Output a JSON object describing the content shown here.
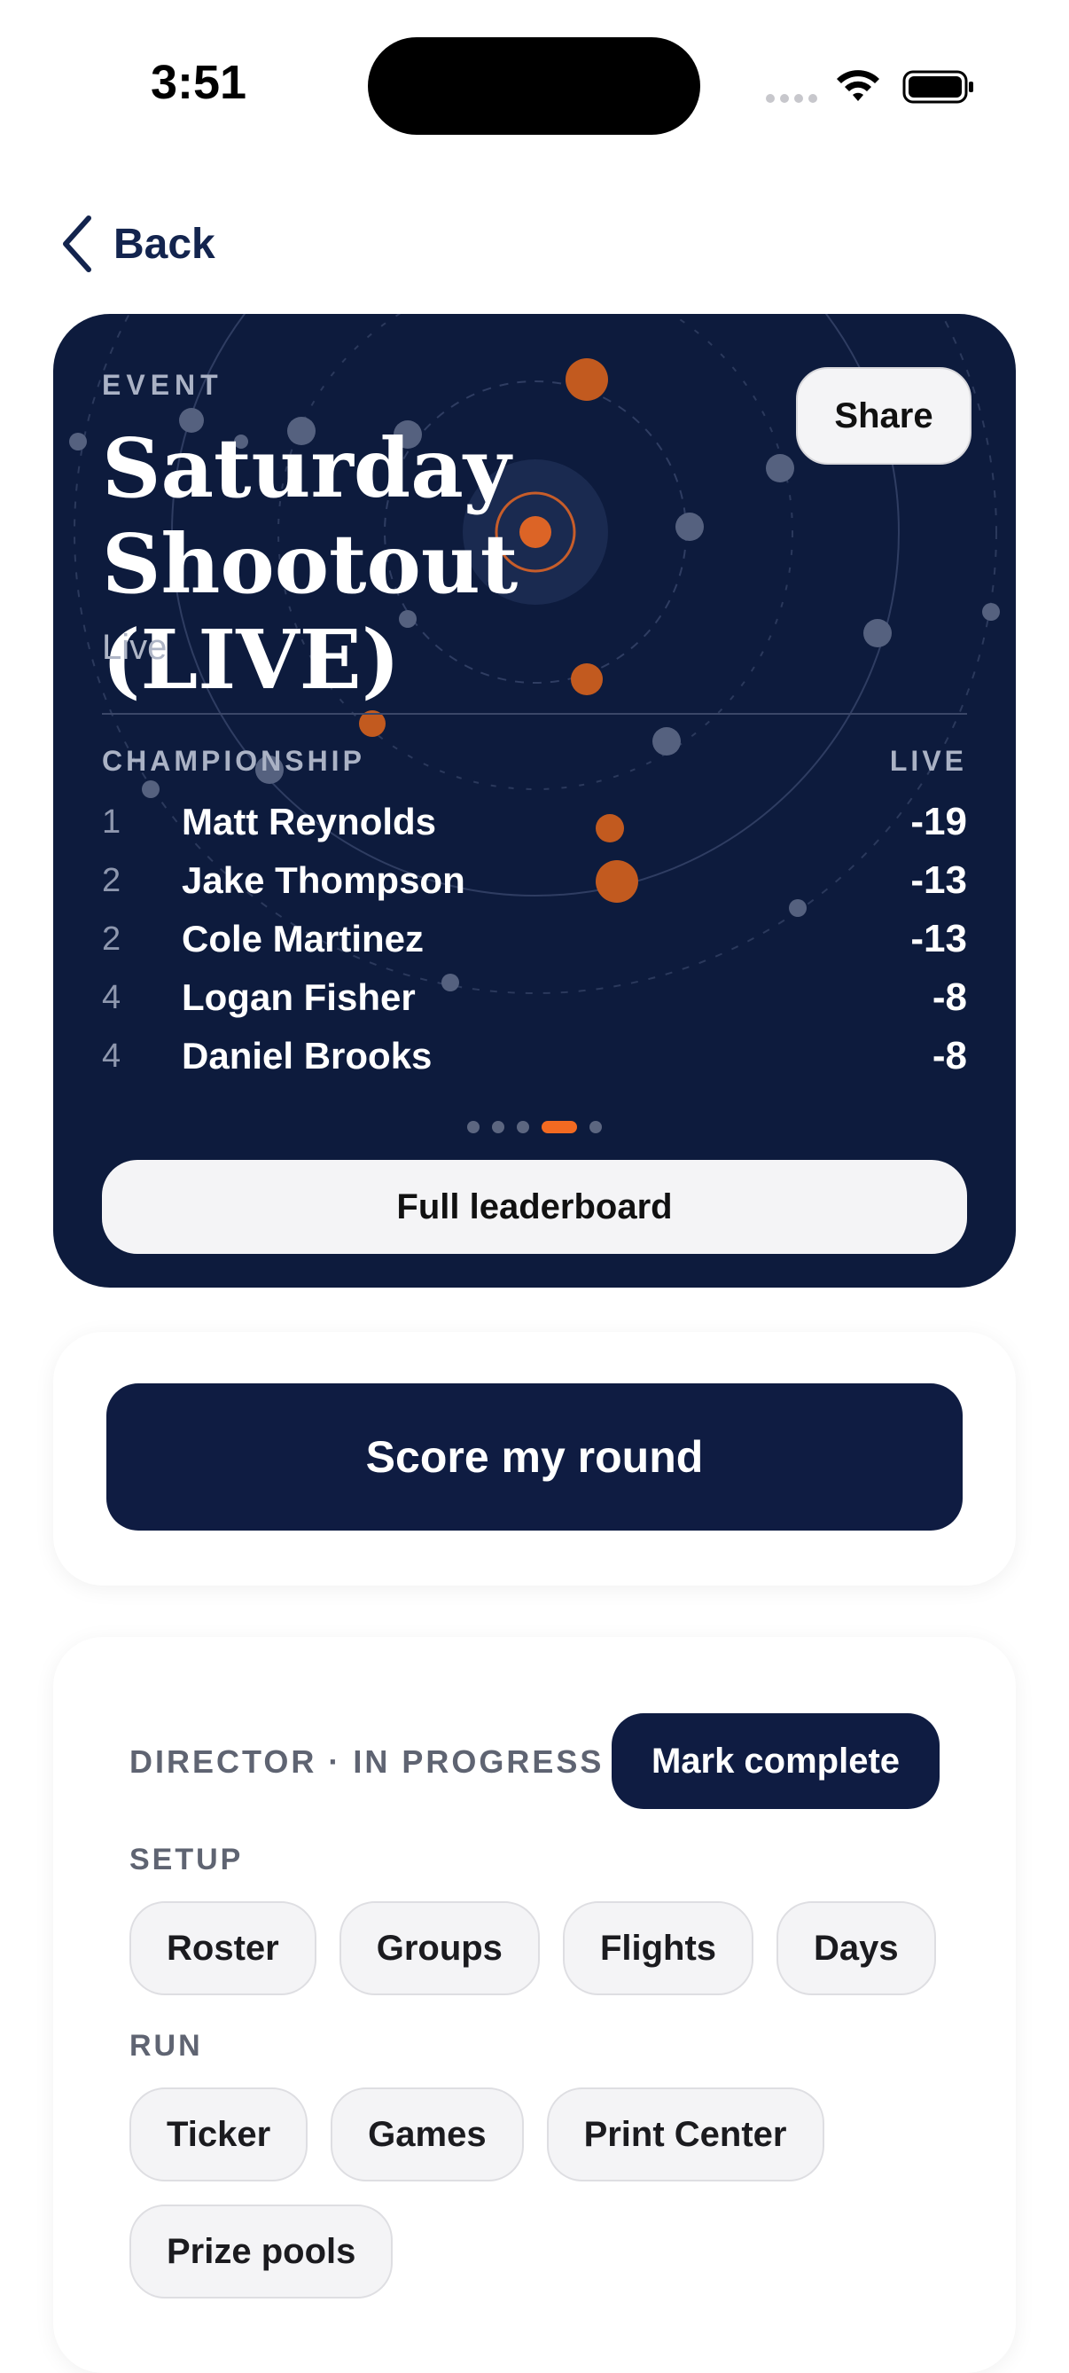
{
  "status_bar": {
    "time": "3:51"
  },
  "nav": {
    "back_label": "Back"
  },
  "event": {
    "kicker": "EVENT",
    "title": "Saturday Shootout (LIVE)",
    "status": "Live",
    "share_label": "Share",
    "leaderboard": {
      "label": "CHAMPIONSHIP",
      "state": "LIVE",
      "rows": [
        {
          "pos": "1",
          "name": "Matt Reynolds",
          "score": "-19"
        },
        {
          "pos": "2",
          "name": "Jake Thompson",
          "score": "-13"
        },
        {
          "pos": "2",
          "name": "Cole Martinez",
          "score": "-13"
        },
        {
          "pos": "4",
          "name": "Logan Fisher",
          "score": "-8"
        },
        {
          "pos": "4",
          "name": "Daniel Brooks",
          "score": "-8"
        }
      ],
      "pager_active": 4,
      "pager_total": 5
    },
    "full_leaderboard_label": "Full leaderboard"
  },
  "score": {
    "button_label": "Score my round"
  },
  "director": {
    "status": "DIRECTOR · IN PROGRESS",
    "mark_complete_label": "Mark complete",
    "setup_label": "SETUP",
    "setup_items": [
      "Roster",
      "Groups",
      "Flights",
      "Days"
    ],
    "run_label": "RUN",
    "run_items": [
      "Ticker",
      "Games",
      "Print Center",
      "Prize pools"
    ]
  },
  "colors": {
    "navy": "#0d1b3d",
    "accent": "#f26a21"
  }
}
